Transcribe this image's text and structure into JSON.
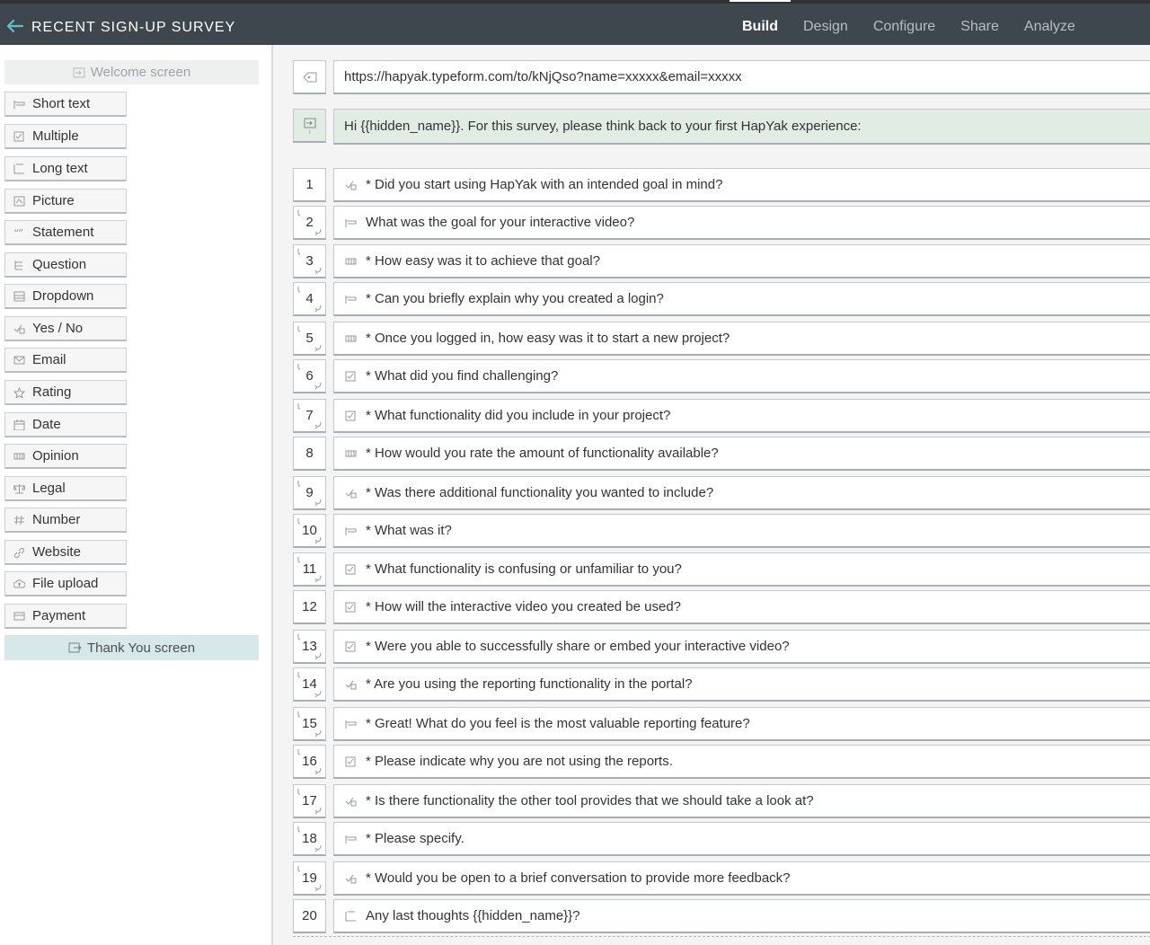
{
  "header": {
    "title": "RECENT SIGN-UP SURVEY",
    "tabs": [
      {
        "label": "Build",
        "active": true
      },
      {
        "label": "Design",
        "active": false
      },
      {
        "label": "Configure",
        "active": false
      },
      {
        "label": "Share",
        "active": false
      },
      {
        "label": "Analyze",
        "active": false
      }
    ]
  },
  "sidebar": {
    "welcome_label": "Welcome screen",
    "thankyou_label": "Thank You screen",
    "question_types": [
      {
        "label": "Short text",
        "icon": "short-text-icon"
      },
      {
        "label": "Multiple",
        "icon": "multiple-choice-icon"
      },
      {
        "label": "Long text",
        "icon": "long-text-icon"
      },
      {
        "label": "Picture",
        "icon": "picture-choice-icon"
      },
      {
        "label": "Statement",
        "icon": "statement-icon"
      },
      {
        "label": "Question",
        "icon": "question-group-icon"
      },
      {
        "label": "Dropdown",
        "icon": "dropdown-icon"
      },
      {
        "label": "Yes / No",
        "icon": "yes-no-icon"
      },
      {
        "label": "Email",
        "icon": "email-icon"
      },
      {
        "label": "Rating",
        "icon": "star-icon"
      },
      {
        "label": "Date",
        "icon": "calendar-icon"
      },
      {
        "label": "Opinion",
        "icon": "opinion-scale-icon"
      },
      {
        "label": "Legal",
        "icon": "scales-icon"
      },
      {
        "label": "Number",
        "icon": "number-icon"
      },
      {
        "label": "Website",
        "icon": "link-icon"
      },
      {
        "label": "File upload",
        "icon": "cloud-upload-icon"
      },
      {
        "label": "Payment",
        "icon": "credit-card-icon"
      }
    ]
  },
  "main": {
    "url": "https://hapyak.typeform.com/to/kNjQso?name=xxxxx&email=xxxxx",
    "intro": "Hi {{hidden_name}}. For this survey, please think back to your first HapYak experience:",
    "questions": [
      {
        "num": "1",
        "text": "* Did you start using HapYak with an intended goal in mind?",
        "type": "yes-no",
        "jump": false
      },
      {
        "num": "2",
        "text": "What was the goal for your interactive video?",
        "type": "short-text",
        "jump": true
      },
      {
        "num": "3",
        "text": "* How easy was it to achieve that goal?",
        "type": "opinion-scale",
        "jump": true
      },
      {
        "num": "4",
        "text": "* Can you briefly explain why you created a login?",
        "type": "short-text",
        "jump": true
      },
      {
        "num": "5",
        "text": "* Once you logged in, how easy was it to start a new project?",
        "type": "opinion-scale",
        "jump": true
      },
      {
        "num": "6",
        "text": "* What did you find challenging?",
        "type": "multiple-choice",
        "jump": true
      },
      {
        "num": "7",
        "text": "* What functionality did you include in your project?",
        "type": "multiple-choice",
        "jump": true
      },
      {
        "num": "8",
        "text": "* How would you rate the amount of functionality available?",
        "type": "opinion-scale",
        "jump": false
      },
      {
        "num": "9",
        "text": "* Was there additional functionality you wanted to include?",
        "type": "yes-no",
        "jump": true
      },
      {
        "num": "10",
        "text": "* What was it?",
        "type": "short-text",
        "jump": true
      },
      {
        "num": "11",
        "text": "* What functionality is confusing or unfamiliar to you?",
        "type": "multiple-choice",
        "jump": true
      },
      {
        "num": "12",
        "text": "* How will the interactive video you created be used?",
        "type": "multiple-choice",
        "jump": false
      },
      {
        "num": "13",
        "text": "* Were you able to successfully share or embed your interactive video?",
        "type": "multiple-choice",
        "jump": true
      },
      {
        "num": "14",
        "text": "* Are you using the reporting functionality in the portal?",
        "type": "yes-no",
        "jump": true
      },
      {
        "num": "15",
        "text": "* Great! What do you feel is the most valuable reporting feature?",
        "type": "short-text",
        "jump": true
      },
      {
        "num": "16",
        "text": "* Please indicate why you are not using the reports.",
        "type": "multiple-choice",
        "jump": true
      },
      {
        "num": "17",
        "text": "* Is there functionality the other tool provides that we should take a look at?",
        "type": "yes-no",
        "jump": true
      },
      {
        "num": "18",
        "text": "* Please specify.",
        "type": "short-text",
        "jump": true
      },
      {
        "num": "19",
        "text": "* Would you be open to a brief conversation to provide more feedback?",
        "type": "yes-no",
        "jump": true
      },
      {
        "num": "20",
        "text": "Any last thoughts {{hidden_name}}?",
        "type": "long-text",
        "jump": false
      }
    ]
  }
}
